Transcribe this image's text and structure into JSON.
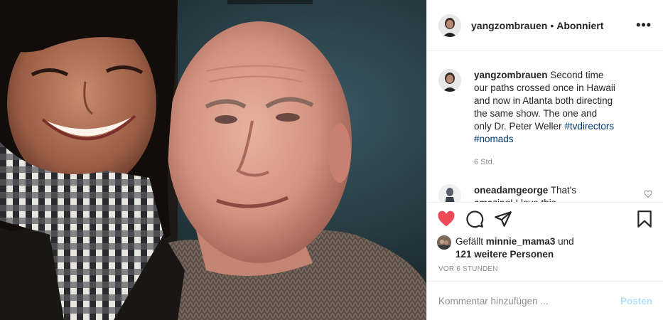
{
  "post": {
    "username": "yangzombrauen",
    "separator": "•",
    "follow_status": "Abonniert",
    "more_glyph": "•••"
  },
  "caption": {
    "username": "yangzombrauen",
    "text": "Second time our paths crossed once in Hawaii and now in Atlanta both directing the same show. The one and only Dr. Peter Weller",
    "hashtags": [
      "#tvdirectors",
      "#nomads"
    ],
    "time": "6 Std."
  },
  "reply": {
    "username": "oneadamgeorge",
    "text": "That's amazing! I love this"
  },
  "likes": {
    "prefix": "Gefällt",
    "first_user": "minnie_mama3",
    "and": "und",
    "others": "121 weitere Personen"
  },
  "post_time": "VOR 6 STUNDEN",
  "add_comment": {
    "placeholder": "Kommentar hinzufügen ...",
    "post_label": "Posten"
  },
  "icons": {
    "like": "heart-filled-icon",
    "comment": "comment-icon",
    "share": "share-icon",
    "save": "bookmark-icon",
    "more": "more-icon",
    "reply_like": "heart-outline-icon"
  },
  "colors": {
    "like_red": "#ed4956",
    "link_blue": "#00376b",
    "muted": "#8e8e8e",
    "post_button": "#b2dffc"
  }
}
